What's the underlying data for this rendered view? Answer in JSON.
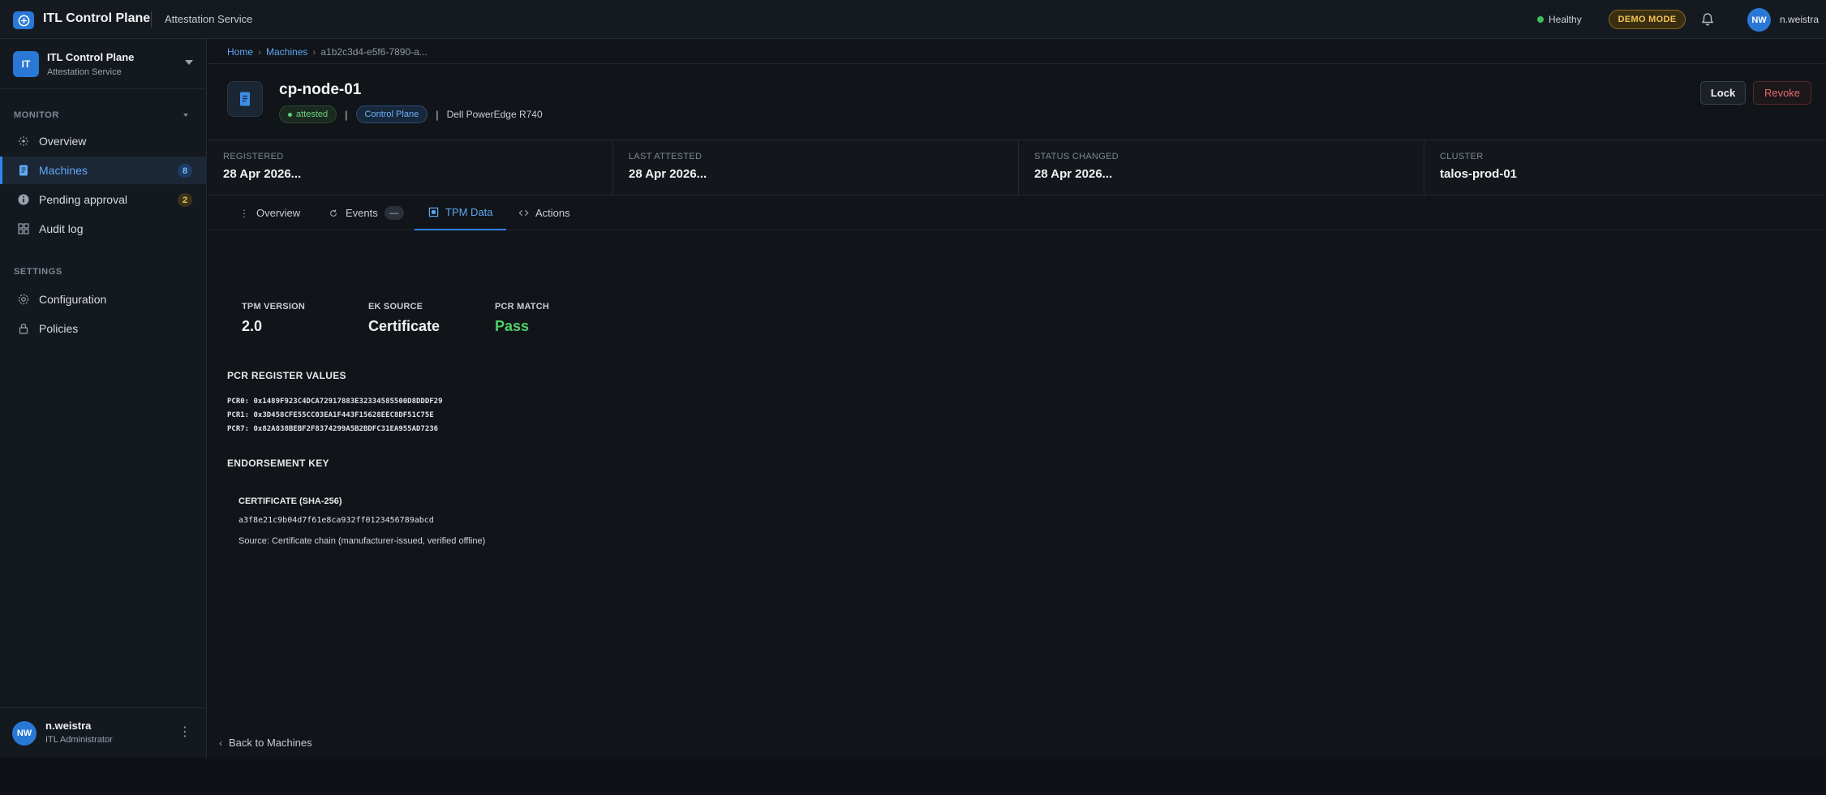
{
  "topbar": {
    "app_title": "ITL Control Plane",
    "service": "Attestation Service",
    "health": "Healthy",
    "demo_badge": "DEMO MODE",
    "user_initials": "NW",
    "user_name": "n.weistra"
  },
  "sidebar": {
    "org_initials": "IT",
    "org_name": "ITL Control Plane",
    "org_sub": "Attestation Service",
    "monitor_label": "MONITOR",
    "settings_label": "SETTINGS",
    "items": [
      {
        "label": "Overview",
        "icon": "sparkle-icon"
      },
      {
        "label": "Machines",
        "icon": "document-icon",
        "badge": "8"
      },
      {
        "label": "Pending approval",
        "icon": "info-icon",
        "badge": "2"
      },
      {
        "label": "Audit log",
        "icon": "grid-icon"
      },
      {
        "label": "Configuration",
        "icon": "gear-icon"
      },
      {
        "label": "Policies",
        "icon": "lock-icon"
      }
    ],
    "footer": {
      "initials": "NW",
      "name": "n.weistra",
      "role": "ITL Administrator"
    }
  },
  "breadcrumb": {
    "home": "Home",
    "machines": "Machines",
    "current": "a1b2c3d4-e5f6-7890-a..."
  },
  "machine": {
    "name": "cp-node-01",
    "status": "attested",
    "role": "Control Plane",
    "hardware": "Dell PowerEdge R740",
    "lock_label": "Lock",
    "revoke_label": "Revoke"
  },
  "stats": [
    {
      "label": "REGISTERED",
      "value": "28 Apr 2026..."
    },
    {
      "label": "LAST ATTESTED",
      "value": "28 Apr 2026..."
    },
    {
      "label": "STATUS CHANGED",
      "value": "28 Apr 2026..."
    },
    {
      "label": "CLUSTER",
      "value": "talos-prod-01"
    }
  ],
  "tabs": [
    {
      "label": "Overview"
    },
    {
      "label": "Events",
      "count": "—"
    },
    {
      "label": "TPM Data"
    },
    {
      "label": "Actions"
    }
  ],
  "tpm": {
    "version_label": "TPM VERSION",
    "version": "2.0",
    "ek_label": "EK SOURCE",
    "ek": "Certificate",
    "pcr_match_label": "PCR MATCH",
    "pcr_match": "Pass",
    "pcr_heading": "PCR REGISTER VALUES",
    "pcrs": [
      "PCR0: 0x1489F923C4DCA72917883E32334585500D8DDDF29",
      "PCR1: 0x3D458CFE55CC03EA1F443F15628EEC8DF51C75E",
      "PCR7: 0x82A838BEBF2F8374299A5B2BDFC31EA955AD7236"
    ],
    "ek_heading": "ENDORSEMENT KEY",
    "cert_label": "CERTIFICATE (SHA-256)",
    "cert_hash": "a3f8e21c9b04d7f61e8ca932ff0123456789abcd",
    "cert_source": "Source: Certificate chain (manufacturer-issued, verified offline)"
  },
  "back_link": "Back to Machines",
  "colors": {
    "accent": "#2f86eb",
    "success": "#4fcf6a",
    "danger": "#e36a6f",
    "warning": "#f0c452"
  }
}
